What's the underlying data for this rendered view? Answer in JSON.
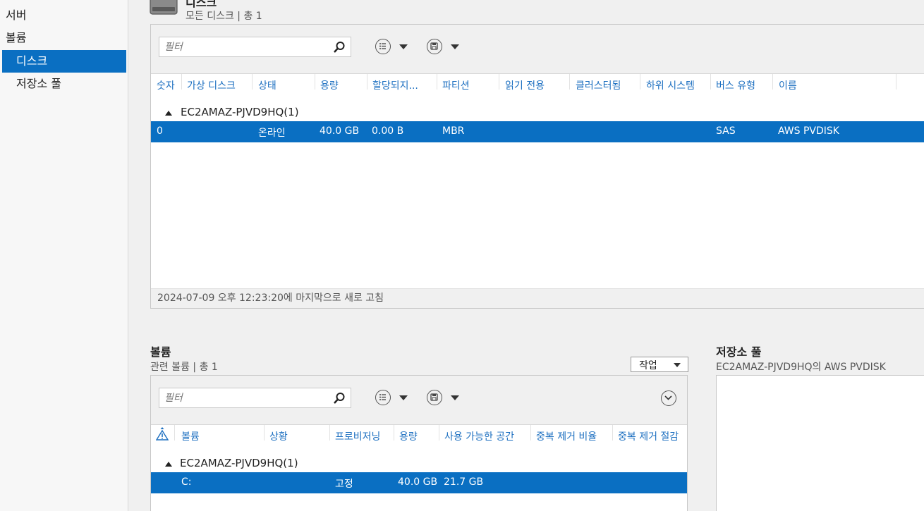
{
  "sidebar": {
    "items": [
      {
        "label": "서버"
      },
      {
        "label": "볼륨"
      },
      {
        "label": "디스크"
      },
      {
        "label": "저장소 풀"
      }
    ]
  },
  "disks": {
    "title": "디스크",
    "subtitle": "모든 디스크 | 총 1",
    "filter_placeholder": "필터",
    "columns": [
      "숫자",
      "가상 디스크",
      "상태",
      "용량",
      "할당되지...",
      "파티션",
      "읽기 전용",
      "클러스터됨",
      "하위 시스템",
      "버스 유형",
      "이름"
    ],
    "group": "EC2AMAZ-PJVD9HQ(1)",
    "rows": [
      {
        "number": "0",
        "status": "온라인",
        "capacity": "40.0 GB",
        "unallocated": "0.00 B",
        "partition": "MBR",
        "bus": "SAS",
        "name": "AWS PVDISK"
      }
    ],
    "footer": "2024-07-09 오후 12:23:20에 마지막으로 새로 고침"
  },
  "volumes": {
    "title": "볼륨",
    "subtitle": "관련 볼륨 | 총 1",
    "task_label": "작업",
    "filter_placeholder": "필터",
    "columns": [
      "볼륨",
      "상황",
      "프로비저닝",
      "용량",
      "사용 가능한 공간",
      "중복 제거 비율",
      "중복 제거 절감"
    ],
    "group": "EC2AMAZ-PJVD9HQ(1)",
    "rows": [
      {
        "volume": "C:",
        "provisioning": "고정",
        "capacity": "40.0 GB",
        "free": "21.7 GB"
      }
    ]
  },
  "pools": {
    "title": "저장소 풀",
    "subtitle": "EC2AMAZ-PJVD9HQ의 AWS PVDISK"
  },
  "colors": {
    "accent": "#0a6fc2",
    "header_text": "#1c6fc0"
  }
}
